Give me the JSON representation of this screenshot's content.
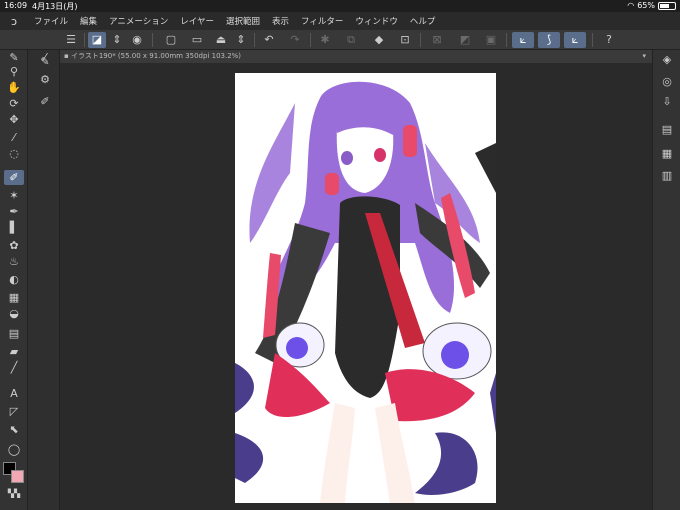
{
  "status": {
    "time": "16:09",
    "date": "4月13日(月)",
    "battery": "65%",
    "battery_level": 0.65
  },
  "menu": {
    "items": [
      "ファイル",
      "編集",
      "アニメーション",
      "レイヤー",
      "選択範囲",
      "表示",
      "フィルター",
      "ウィンドウ",
      "ヘルプ"
    ]
  },
  "canvas": {
    "tab_title": "イラスト190* (55.00 x 91.00mm 350dpi 103.2%)"
  },
  "colors": {
    "main": "#000000",
    "sub": "#f2a7b4",
    "accent": "#5a6e8c"
  },
  "icons": {
    "toolbar": [
      "menu-icon",
      "layer-select-icon",
      "stepper-icon",
      "brush-size-icon",
      "new-canvas-icon",
      "open-icon",
      "save-icon",
      "undo-icon",
      "redo-icon",
      "transform-icon",
      "fill-icon",
      "crop-icon",
      "stabilizer-icon",
      "help-icon"
    ],
    "tools": [
      "pen-icon",
      "zoom-icon",
      "hand-icon",
      "rotate-icon",
      "move-icon",
      "eyedropper-icon",
      "lasso-icon",
      "brush-icon",
      "star-icon",
      "pen-tool-icon",
      "marker-icon",
      "airbrush-icon",
      "water-icon",
      "blur-icon",
      "gradient-icon",
      "fill-bucket-icon",
      "eraser-icon",
      "line-icon",
      "text-icon",
      "ruler-icon",
      "select-icon",
      "balloon-icon"
    ]
  }
}
